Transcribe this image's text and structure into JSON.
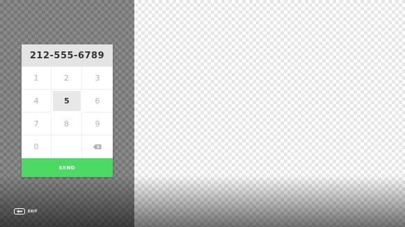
{
  "dialer": {
    "number": "212-555-6789",
    "keys": {
      "k1": "1",
      "k2": "2",
      "k3": "3",
      "k4": "4",
      "k5": "5",
      "k6": "6",
      "k7": "7",
      "k8": "8",
      "k9": "9",
      "k0": "0"
    },
    "selected_key": "5",
    "backspace_icon": "backspace-icon",
    "send_label": "SEND"
  },
  "footer": {
    "exit_icon": "back-arrow-icon",
    "exit_label": "EXIT"
  },
  "colors": {
    "send_accent": "#4cd964",
    "display_bg": "#e4e4e4"
  }
}
